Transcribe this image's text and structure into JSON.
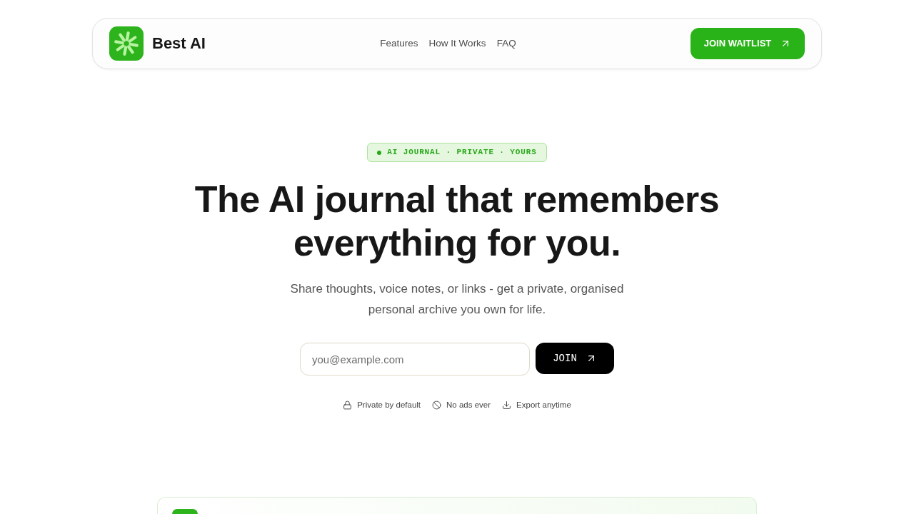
{
  "header": {
    "logo_text": "Best AI",
    "nav": [
      {
        "label": "Features"
      },
      {
        "label": "How It Works"
      },
      {
        "label": "FAQ"
      }
    ],
    "cta": "JOIN WAITLIST"
  },
  "hero": {
    "badge": "AI JOURNAL · PRIVATE · YOURS",
    "headline": "The AI journal that remembers everything for you.",
    "subtitle": "Share thoughts, voice notes, or links - get a private, organised personal archive you own for life.",
    "email": {
      "placeholder": "you@example.com"
    },
    "submit": "JOIN",
    "perks": [
      {
        "kind": "lock",
        "label": "Private by default"
      },
      {
        "kind": "ban",
        "label": "No ads ever"
      },
      {
        "kind": "download",
        "label": "Export anytime"
      }
    ]
  }
}
